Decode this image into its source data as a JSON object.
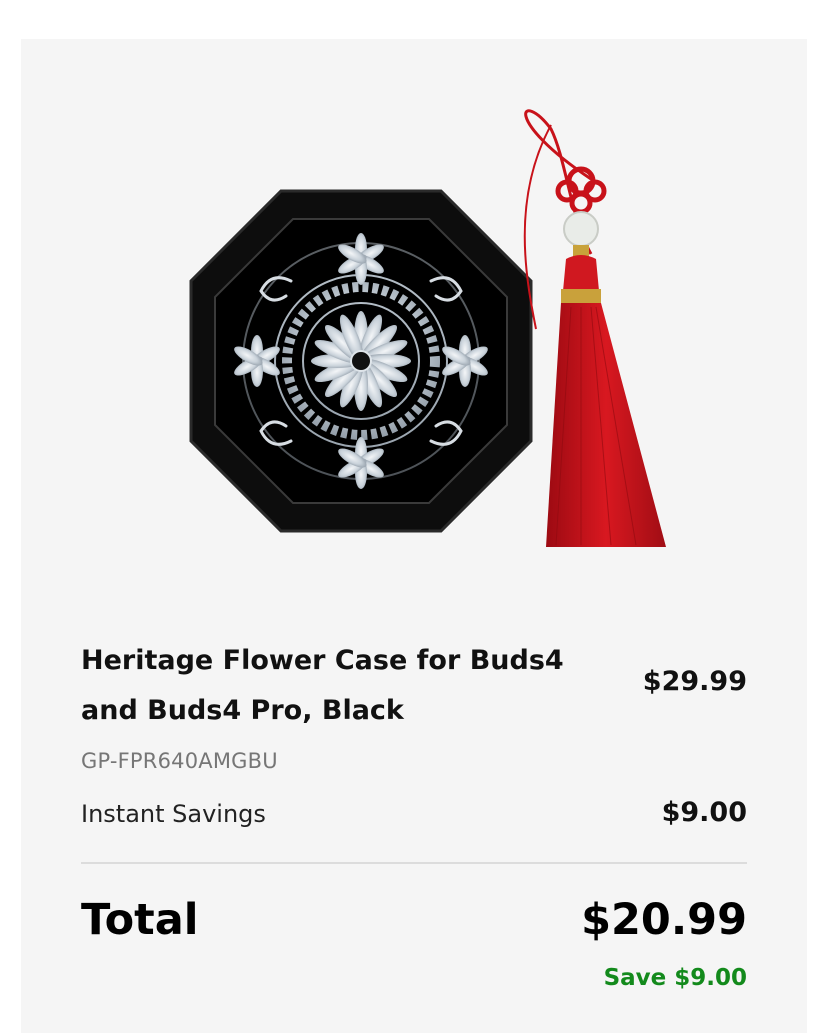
{
  "product": {
    "image_alt": "Heritage Flower Case with red tassel",
    "name": "Heritage Flower Case for Buds4 and Buds4 Pro, Black",
    "price": "$29.99",
    "sku": "GP-FPR640AMGBU"
  },
  "savings": {
    "label": "Instant Savings",
    "value": "$9.00"
  },
  "total": {
    "label": "Total",
    "value": "$20.99",
    "save_text": "Save $9.00"
  },
  "colors": {
    "card_background": "#f5f5f5",
    "save_green": "#138a1c",
    "tassel_red": "#c8121a"
  }
}
